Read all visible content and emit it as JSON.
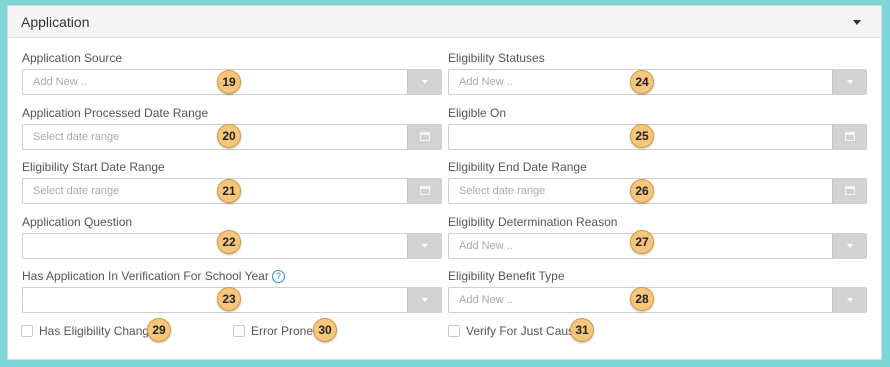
{
  "panel": {
    "title": "Application"
  },
  "fields": {
    "application_source": {
      "label": "Application Source",
      "placeholder": "Add New ..",
      "badge": "19"
    },
    "processed_date_range": {
      "label": "Application Processed Date Range",
      "placeholder": "Select date range",
      "badge": "20"
    },
    "eligibility_start": {
      "label": "Eligibility Start Date Range",
      "placeholder": "Select date range",
      "badge": "21"
    },
    "application_question": {
      "label": "Application Question",
      "placeholder": "",
      "badge": "22"
    },
    "has_verification": {
      "label": "Has Application In Verification For School Year",
      "help": "?",
      "placeholder": "",
      "badge": "23"
    },
    "eligibility_statuses": {
      "label": "Eligibility Statuses",
      "placeholder": "Add New ..",
      "badge": "24"
    },
    "eligible_on": {
      "label": "Eligible On",
      "placeholder": "",
      "badge": "25"
    },
    "eligibility_end": {
      "label": "Eligibility End Date Range",
      "placeholder": "Select date range",
      "badge": "26"
    },
    "determination_reason": {
      "label": "Eligibility Determination Reason",
      "placeholder": "Add New ..",
      "badge": "27"
    },
    "benefit_type": {
      "label": "Eligibility Benefit Type",
      "placeholder": "Add New ..",
      "badge": "28"
    }
  },
  "checkboxes": {
    "eligibility_change": {
      "label": "Has Eligibility Change",
      "badge": "29"
    },
    "error_prone": {
      "label": "Error Prone",
      "badge": "30"
    },
    "just_cause": {
      "label": "Verify For Just Cause",
      "badge": "31"
    }
  },
  "colors": {
    "background": "#7fd6d6",
    "badge": "#f7c67d",
    "addon": "#d2d2d2"
  }
}
